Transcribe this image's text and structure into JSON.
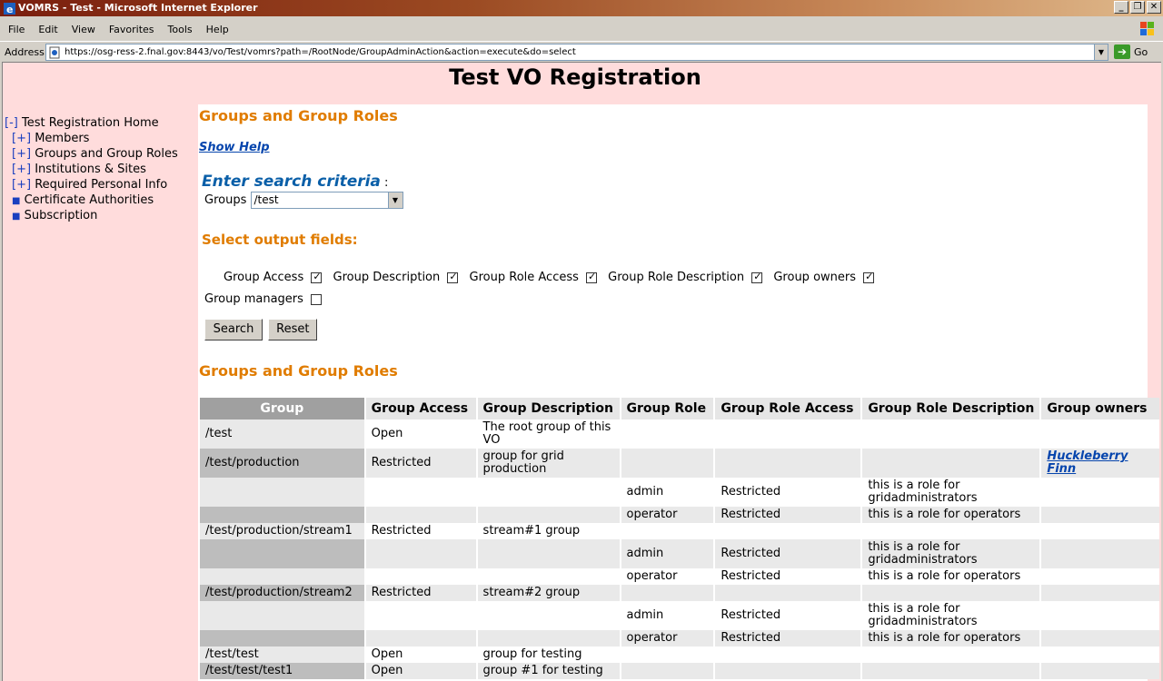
{
  "window": {
    "title": "VOMRS - Test - Microsoft Internet Explorer"
  },
  "menu": [
    "File",
    "Edit",
    "View",
    "Favorites",
    "Tools",
    "Help"
  ],
  "address": {
    "label": "Address",
    "url": "https://osg-ress-2.fnal.gov:8443/vo/Test/vomrs?path=/RootNode/GroupAdminAction&action=execute&do=select",
    "go_label": "Go"
  },
  "page": {
    "title": "Test VO Registration"
  },
  "nav": {
    "home": {
      "toggle": "[-]",
      "label": "Test Registration Home"
    },
    "items": [
      {
        "toggle": "[+]",
        "label": "Members"
      },
      {
        "toggle": "[+]",
        "label": "Groups and Group Roles"
      },
      {
        "toggle": "[+]",
        "label": "Institutions & Sites"
      },
      {
        "toggle": "[+]",
        "label": "Required Personal Info"
      }
    ],
    "leaves": [
      {
        "label": "Certificate Authorities"
      },
      {
        "label": "Subscription"
      }
    ]
  },
  "main": {
    "section_title": "Groups and Group Roles",
    "show_help": "Show Help",
    "search_title": "Enter search criteria",
    "search_colon": ":",
    "groups_label": "Groups",
    "groups_value": "/test",
    "output_title": "Select output fields:",
    "fields": [
      {
        "label": "Group Access",
        "checked": true
      },
      {
        "label": "Group Description",
        "checked": true
      },
      {
        "label": "Group Role Access",
        "checked": true
      },
      {
        "label": "Group Role Description",
        "checked": true
      },
      {
        "label": "Group owners",
        "checked": true
      },
      {
        "label": "Group managers",
        "checked": false
      }
    ],
    "search_button": "Search",
    "reset_button": "Reset",
    "results_title": "Groups and Group Roles"
  },
  "table": {
    "columns": [
      "Group",
      "Group Access",
      "Group Description",
      "Group Role",
      "Group Role Access",
      "Group Role Description",
      "Group owners"
    ],
    "rows": [
      [
        "/test",
        "Open",
        "The root group of this VO",
        "",
        "",
        "",
        ""
      ],
      [
        "/test/production",
        "Restricted",
        "group for grid production",
        "",
        "",
        "",
        "Huckleberry Finn"
      ],
      [
        "",
        "",
        "",
        "admin",
        "Restricted",
        "this is a role for gridadministrators",
        ""
      ],
      [
        "",
        "",
        "",
        "operator",
        "Restricted",
        "this is a role for operators",
        ""
      ],
      [
        "/test/production/stream1",
        "Restricted",
        "stream#1 group",
        "",
        "",
        "",
        ""
      ],
      [
        "",
        "",
        "",
        "admin",
        "Restricted",
        "this is a role for gridadministrators",
        ""
      ],
      [
        "",
        "",
        "",
        "operator",
        "Restricted",
        "this is a role for operators",
        ""
      ],
      [
        "/test/production/stream2",
        "Restricted",
        "stream#2 group",
        "",
        "",
        "",
        ""
      ],
      [
        "",
        "",
        "",
        "admin",
        "Restricted",
        "this is a role for gridadministrators",
        ""
      ],
      [
        "",
        "",
        "",
        "operator",
        "Restricted",
        "this is a role for operators",
        ""
      ],
      [
        "/test/test",
        "Open",
        "group for testing",
        "",
        "",
        "",
        ""
      ],
      [
        "/test/test/test1",
        "Open",
        "group #1 for testing",
        "",
        "",
        "",
        ""
      ]
    ]
  }
}
